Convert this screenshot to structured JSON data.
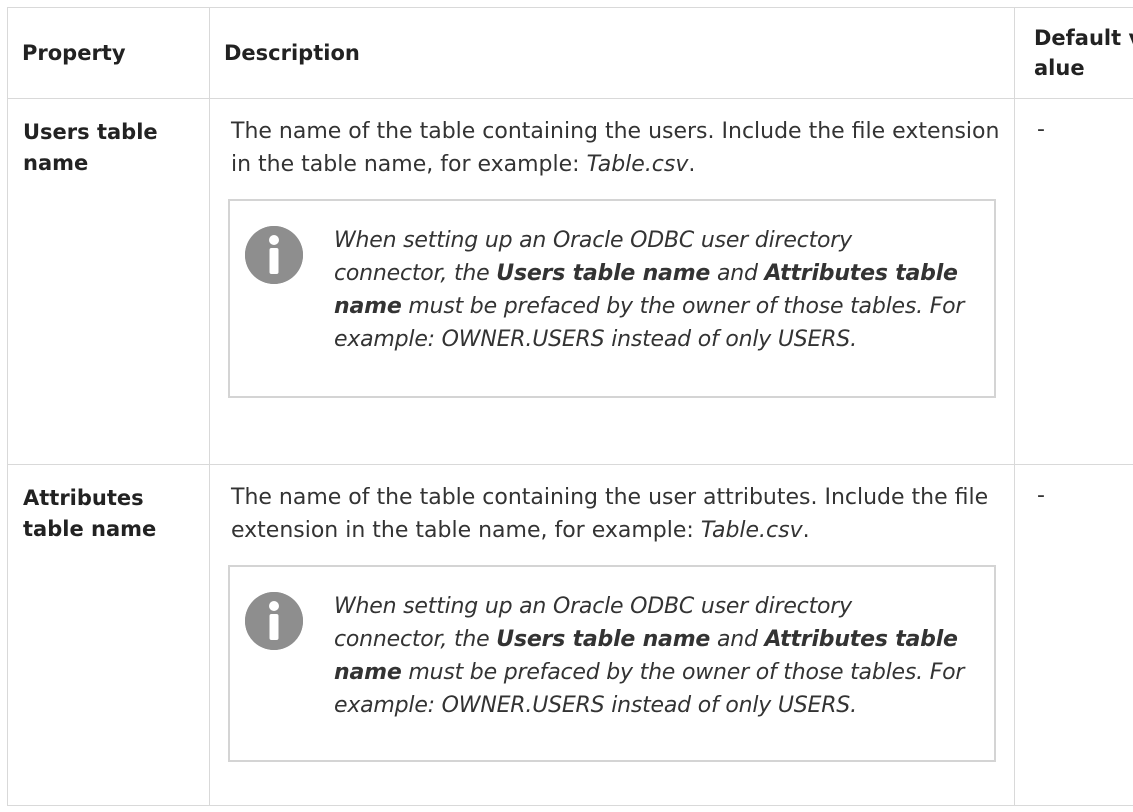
{
  "table": {
    "headers": {
      "property": "Property",
      "description": "Description",
      "default_value": "Default value"
    },
    "rows": [
      {
        "property": "Users table name",
        "description": {
          "text": "The name of the table containing the users. Include the file extension in the table name, for example:",
          "example": "Table.csv",
          "suffix": "."
        },
        "note": {
          "icon": "info-icon",
          "seg1": "When setting up an Oracle ODBC user directory connector, the ",
          "bold1": "Users table name",
          "seg2": " and ",
          "bold2": "Attributes table name",
          "seg3": " must be prefaced by the owner of those tables. For example: OWNER.USERS instead of only USERS."
        },
        "default_value": "-"
      },
      {
        "property": "Attributes table name",
        "description": {
          "text": "The name of the table containing the user attributes. Include the file extension in the table name, for example:",
          "example": "Table.csv",
          "suffix": "."
        },
        "note": {
          "icon": "info-icon",
          "seg1": "When setting up an Oracle ODBC user directory connector, the ",
          "bold1": "Users table name",
          "seg2": " and ",
          "bold2": "Attributes table name",
          "seg3": " must be prefaced by the owner of those tables. For example: OWNER.USERS instead of only USERS."
        },
        "default_value": "-"
      }
    ]
  },
  "colors": {
    "border": "#d9d9d9",
    "note_border": "#d4d4d4",
    "icon": "#8e8e8e",
    "text": "#333333"
  }
}
